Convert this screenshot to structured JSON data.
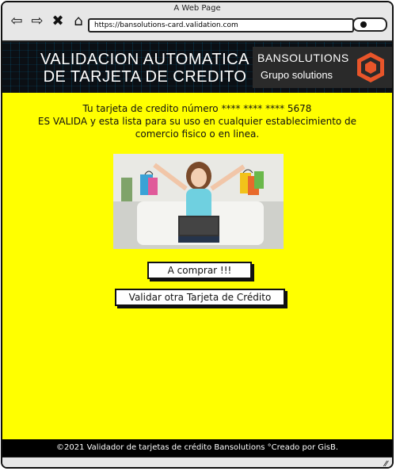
{
  "browser": {
    "window_title": "A Web Page",
    "url": "https://bansolutions-card.validation.com",
    "nav_icons": [
      "back-icon",
      "forward-icon",
      "close-icon",
      "home-icon"
    ]
  },
  "hero": {
    "title_line1": "VALIDACION AUTOMATICA",
    "title_line2": "DE TARJETA DE CREDITO",
    "brand_name": "BANSOLUTIONS",
    "brand_sub": "Grupo solutions"
  },
  "main": {
    "line1": "Tu tarjeta de credito número  **** **** **** 5678",
    "line2": "ES VALIDA y esta lista para su uso en cualquier establecimiento de",
    "line3": "comercio fisico o en linea.",
    "buy_button": "A comprar !!!",
    "validate_button": "Validar otra Tarjeta de Crédito"
  },
  "footer": {
    "text": "©2021 Validador de tarjetas de crédito Bansolutions °Creado por GisB."
  },
  "colors": {
    "content_bg": "#ffff00",
    "hero_bg": "#0b0f14",
    "logo": "#e8552a"
  }
}
